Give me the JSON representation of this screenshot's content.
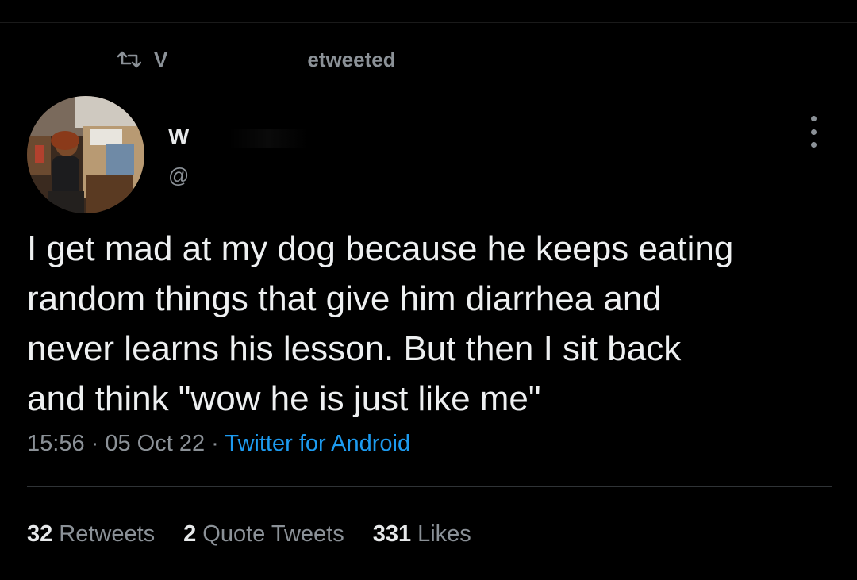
{
  "banner": {
    "name_fragment": "V",
    "retweeted_label": "etweeted"
  },
  "author": {
    "name_fragment": "W",
    "handle_fragment": "@"
  },
  "tweet": {
    "text": "I get mad at my dog because he keeps eating\nrandom things that give him diarrhea and\nnever learns his lesson. But then I sit back\nand think \"wow he is just like me\"",
    "time": "15:56",
    "sep1": " · ",
    "date": "05 Oct 22",
    "sep2": " · ",
    "source": "Twitter for Android"
  },
  "stats": {
    "retweets_count": "32",
    "retweets_label": "Retweets",
    "quotes_count": "2",
    "quotes_label": "Quote Tweets",
    "likes_count": "331",
    "likes_label": "Likes"
  },
  "colors": {
    "background": "#000000",
    "text": "#e7e9ea",
    "muted": "#8b9197",
    "link": "#1d9bf0"
  }
}
